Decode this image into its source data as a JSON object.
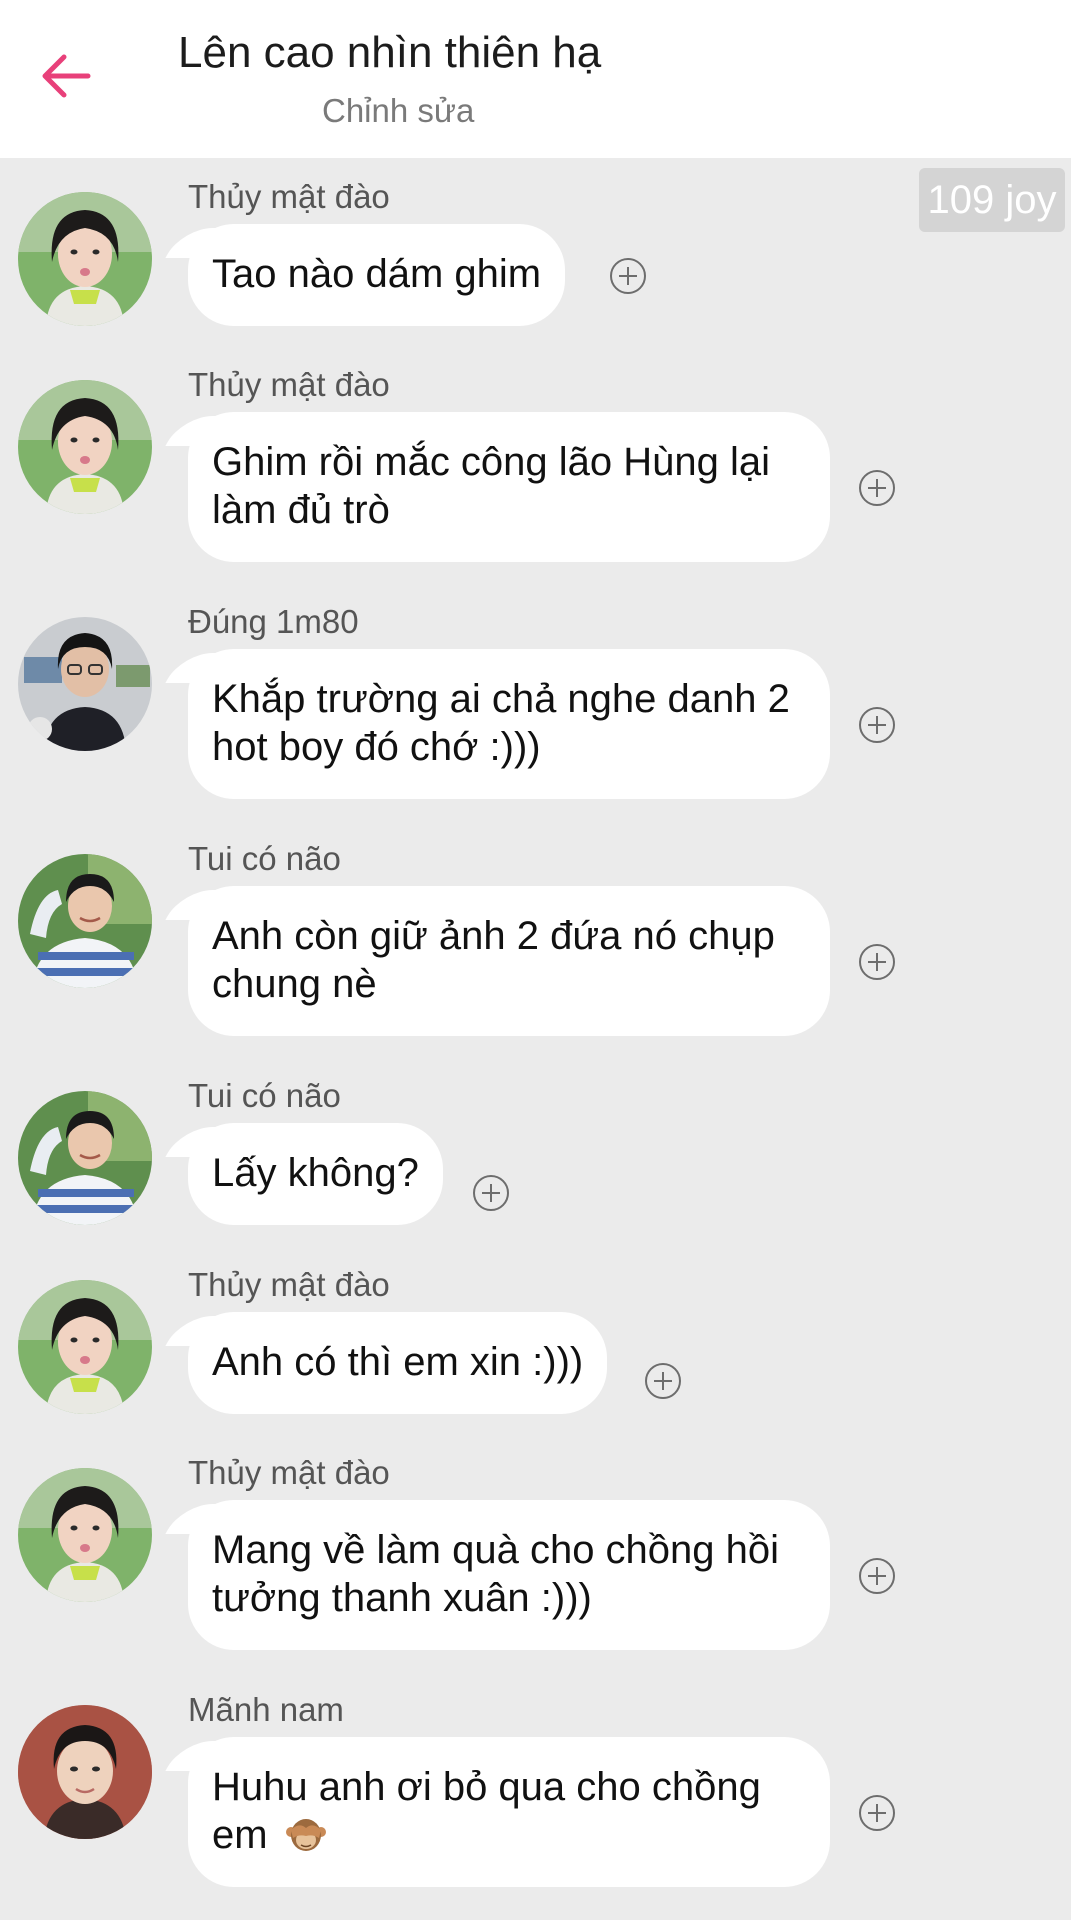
{
  "header": {
    "title": "Lên cao nhìn thiên hạ",
    "subtitle": "Chỉnh sửa",
    "accent_color": "#e8407a"
  },
  "badge": {
    "text": "109 joy"
  },
  "messages": [
    {
      "sender": "Thủy mật đào",
      "text": "Tao nào dám ghim",
      "avatar": "girl-avatar"
    },
    {
      "sender": "Thủy mật đào",
      "text": "Ghim rồi mắc công lão Hùng lại làm đủ trò",
      "avatar": "girl-avatar"
    },
    {
      "sender": "Đúng 1m80",
      "text": "Khắp trường ai chả nghe danh 2 hot boy đó chớ :)))",
      "avatar": "boy-glasses-avatar"
    },
    {
      "sender": "Tui có não",
      "text": "Anh còn giữ ảnh 2 đứa nó chụp chung nè",
      "avatar": "boy-striped-avatar"
    },
    {
      "sender": "Tui có não",
      "text": "Lấy không?",
      "avatar": "boy-striped-avatar"
    },
    {
      "sender": "Thủy mật đào",
      "text": "Anh có thì em xin :)))",
      "avatar": "girl-avatar"
    },
    {
      "sender": "Thủy mật đào",
      "text": "Mang về làm quà cho chồng hồi tưởng thanh xuân :)))",
      "avatar": "girl-avatar"
    },
    {
      "sender": "Mãnh nam",
      "text": "Huhu anh ơi bỏ qua cho chồng em",
      "emoji": "see-no-evil-monkey",
      "avatar": "boy-portrait-avatar"
    }
  ]
}
